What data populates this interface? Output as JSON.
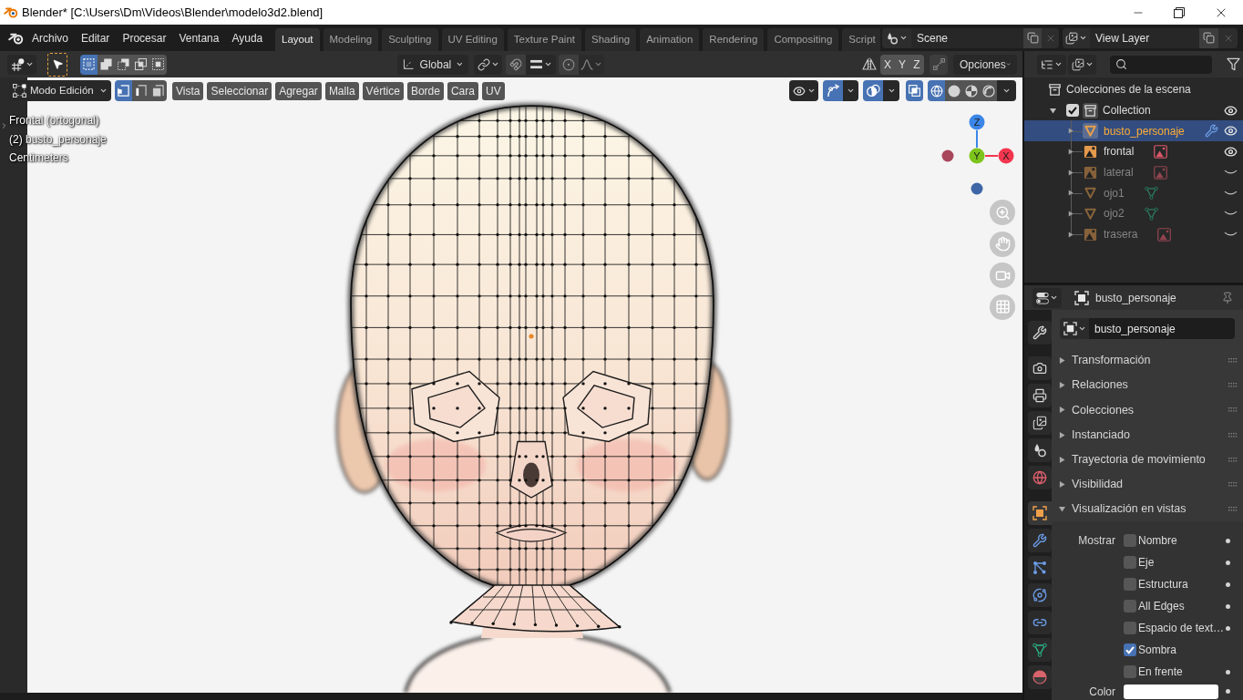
{
  "window": {
    "title": "Blender* [C:\\Users\\Dm\\Videos\\Blender\\modelo3d2.blend]"
  },
  "menu": [
    "Archivo",
    "Editar",
    "Procesar",
    "Ventana",
    "Ayuda"
  ],
  "workspace_tabs": [
    {
      "label": "Layout",
      "selected": true
    },
    {
      "label": "Modeling",
      "selected": false
    },
    {
      "label": "Sculpting",
      "selected": false
    },
    {
      "label": "UV Editing",
      "selected": false
    },
    {
      "label": "Texture Paint",
      "selected": false
    },
    {
      "label": "Shading",
      "selected": false
    },
    {
      "label": "Animation",
      "selected": false
    },
    {
      "label": "Rendering",
      "selected": false
    },
    {
      "label": "Compositing",
      "selected": false
    },
    {
      "label": "Script",
      "selected": false
    }
  ],
  "scene": {
    "value": "Scene"
  },
  "view_layer": {
    "value": "View Layer"
  },
  "tool_header": {
    "select_modes": [
      {
        "kind": "set",
        "selected": true
      },
      {
        "kind": "extend",
        "selected": false
      },
      {
        "kind": "subtract",
        "selected": false
      },
      {
        "kind": "difference",
        "selected": false
      },
      {
        "kind": "intersect",
        "selected": false
      }
    ],
    "orientation": "Global",
    "snap_on": false,
    "proportional_on": false,
    "mirror_axes": [
      {
        "label": "X",
        "on": false
      },
      {
        "label": "Y",
        "on": false
      },
      {
        "label": "Z",
        "on": false
      }
    ],
    "options": "Opciones"
  },
  "viewport_header": {
    "mode": "Modo Edición",
    "element_modes": [
      {
        "kind": "vertex",
        "selected": true
      },
      {
        "kind": "edge",
        "selected": false
      },
      {
        "kind": "face",
        "selected": false
      }
    ],
    "menus": [
      "Vista",
      "Seleccionar",
      "Agregar",
      "Malla",
      "Vértice",
      "Borde",
      "Cara",
      "UV"
    ],
    "gizmos_on": true,
    "overlays_on": true,
    "xray_on": true,
    "shading": [
      {
        "kind": "wireframe",
        "selected": true
      },
      {
        "kind": "solid",
        "selected": false
      },
      {
        "kind": "material",
        "selected": false
      },
      {
        "kind": "rendered",
        "selected": false
      }
    ]
  },
  "viewport": {
    "info": [
      "Frontal (ortogonal)",
      "(2) busto_personaje",
      "Centimeters"
    ],
    "axes": [
      {
        "label": "Z",
        "color": "#3b86e8"
      },
      {
        "label": "Y",
        "color": "#7dc41c"
      },
      {
        "label": "X",
        "color": "#f3364f"
      }
    ]
  },
  "outliner": {
    "root": "Colecciones de la escena",
    "collections": [
      {
        "label": "Collection",
        "expanded": true,
        "checked": true,
        "active": true,
        "visible": true,
        "children": [
          {
            "label": "busto_personaje",
            "kind": "mesh",
            "selected": true,
            "visible": true,
            "badges": [
              {
                "kind": "modifier"
              }
            ]
          },
          {
            "label": "frontal",
            "kind": "image",
            "selected": false,
            "visible": true,
            "badges": [
              {
                "kind": "image_data"
              }
            ]
          },
          {
            "label": "lateral",
            "kind": "image",
            "selected": false,
            "visible": false,
            "badges": [
              {
                "kind": "image_data"
              }
            ]
          },
          {
            "label": "ojo1",
            "kind": "mesh",
            "selected": false,
            "visible": false,
            "badges": [
              {
                "kind": "mesh_data"
              }
            ]
          },
          {
            "label": "ojo2",
            "kind": "mesh",
            "selected": false,
            "visible": false,
            "badges": [
              {
                "kind": "mesh_data"
              }
            ]
          },
          {
            "label": "trasera",
            "kind": "image",
            "selected": false,
            "visible": false,
            "badges": [
              {
                "kind": "image_data"
              }
            ]
          }
        ]
      }
    ]
  },
  "properties": {
    "title": "busto_personaje",
    "tabs": [
      [
        {
          "kind": "tool",
          "selected": false
        }
      ],
      [
        {
          "kind": "render",
          "selected": false
        },
        {
          "kind": "output",
          "selected": false
        },
        {
          "kind": "view_layer",
          "selected": false
        },
        {
          "kind": "scene",
          "selected": false
        },
        {
          "kind": "world",
          "selected": false
        }
      ],
      [
        {
          "kind": "object",
          "selected": true
        },
        {
          "kind": "modifiers",
          "selected": false
        },
        {
          "kind": "particles",
          "selected": false
        },
        {
          "kind": "physics",
          "selected": false
        },
        {
          "kind": "constraints",
          "selected": false
        },
        {
          "kind": "data",
          "selected": false
        },
        {
          "kind": "material",
          "selected": false
        }
      ]
    ],
    "object_name": "busto_personaje",
    "panels": [
      {
        "label": "Transformación",
        "expanded": false
      },
      {
        "label": "Relaciones",
        "expanded": false
      },
      {
        "label": "Colecciones",
        "expanded": false
      },
      {
        "label": "Instanciado",
        "expanded": false
      },
      {
        "label": "Trayectoria de movimiento",
        "expanded": false
      },
      {
        "label": "Visibilidad",
        "expanded": false
      },
      {
        "label": "Visualización en vistas",
        "expanded": true,
        "content": {
          "label": "Mostrar",
          "options": [
            {
              "label": "Nombre",
              "checked": false,
              "animatable": true
            },
            {
              "label": "Eje",
              "checked": false,
              "animatable": true
            },
            {
              "label": "Estructura",
              "checked": false,
              "animatable": true
            },
            {
              "label": "All Edges",
              "checked": false,
              "animatable": true
            },
            {
              "label": "Espacio de text…",
              "checked": false,
              "animatable": true
            },
            {
              "label": "Sombra",
              "checked": true,
              "animatable": false
            },
            {
              "label": "En frente",
              "checked": false,
              "animatable": true
            }
          ],
          "color": {
            "label": "Color",
            "animatable": true
          }
        }
      }
    ]
  }
}
